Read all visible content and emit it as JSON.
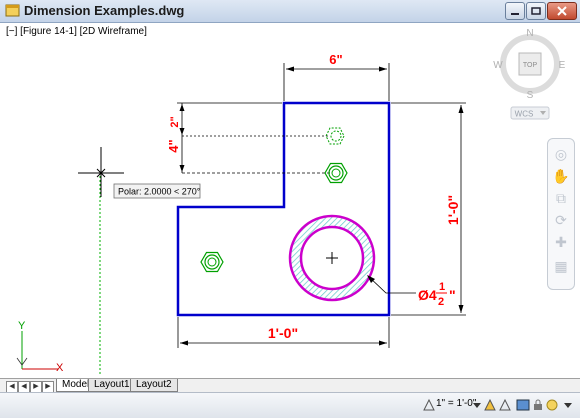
{
  "window": {
    "title": "Dimension Examples.dwg"
  },
  "viewport": {
    "label": "[−] [Figure 14-1] [2D Wireframe]"
  },
  "viewcube": {
    "north": "N",
    "south": "S",
    "east": "E",
    "west": "W",
    "face": "TOP",
    "wcs": "WCS"
  },
  "drawing": {
    "dim_top": "6\"",
    "dim_left_big": "4\"",
    "dim_left_small": "2\"",
    "dim_right": "1'-0\"",
    "dim_bottom": "1'-0\"",
    "dia_prefix": "Ø4",
    "dia_num": "1",
    "dia_den": "2",
    "dia_suffix": "\""
  },
  "tooltip": {
    "text": "Polar: 2.0000 < 270°"
  },
  "ucs": {
    "x_label": "X",
    "y_label": "Y"
  },
  "tabs": [
    "Model",
    "Layout1",
    "Layout2"
  ],
  "status": {
    "scale": "1\" = 1'-0\""
  },
  "colors": {
    "outline": "#0000cc",
    "dimension": "#ff0000",
    "hole": "#cc00cc",
    "hex": "#00a000"
  }
}
